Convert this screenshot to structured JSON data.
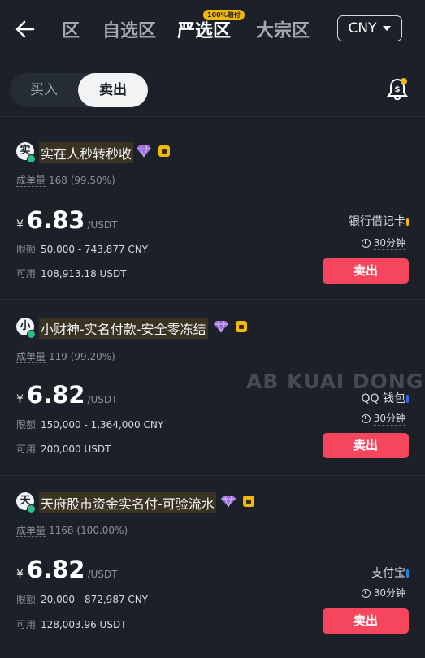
{
  "header": {
    "tabs": [
      {
        "label": "社区"
      },
      {
        "label": "自选区"
      },
      {
        "label": "严选区",
        "badge": "100%赔付"
      },
      {
        "label": "大宗区"
      }
    ],
    "currency": "CNY"
  },
  "toggle": {
    "buy": "买入",
    "sell": "卖出"
  },
  "watermark": "AB KUAI DONG",
  "ads": [
    {
      "avatar": "实",
      "name": "实在人秒转秒收",
      "orders_label": "成单量",
      "orders_value": "168 (99.50%)",
      "currency_symbol": "¥",
      "price": "6.83",
      "unit": "/USDT",
      "limit_label": "限额",
      "limit_value": "50,000 - 743,877 CNY",
      "available_label": "可用",
      "available_value": "108,913.18 USDT",
      "payment": "银行借记卡",
      "payment_color": "#f0b90b",
      "time": "30分钟",
      "button": "卖出"
    },
    {
      "avatar": "小",
      "name": "小财神-实名付款-安全零冻结",
      "orders_label": "成单量",
      "orders_value": "119 (99.20%)",
      "currency_symbol": "¥",
      "price": "6.82",
      "unit": "/USDT",
      "limit_label": "限额",
      "limit_value": "150,000 - 1,364,000 CNY",
      "available_label": "可用",
      "available_value": "200,000 USDT",
      "payment": "QQ 钱包",
      "payment_color": "#2e6be6",
      "time": "30分钟",
      "button": "卖出"
    },
    {
      "avatar": "天",
      "name": "天府股市资金实名付-可验流水",
      "orders_label": "成单量",
      "orders_value": "1168 (100.00%)",
      "currency_symbol": "¥",
      "price": "6.82",
      "unit": "/USDT",
      "limit_label": "限额",
      "limit_value": "20,000 - 872,987 CNY",
      "available_label": "可用",
      "available_value": "128,003.96 USDT",
      "payment": "支付宝",
      "payment_color": "#1e88e5",
      "time": "30分钟",
      "button": "卖出"
    }
  ]
}
